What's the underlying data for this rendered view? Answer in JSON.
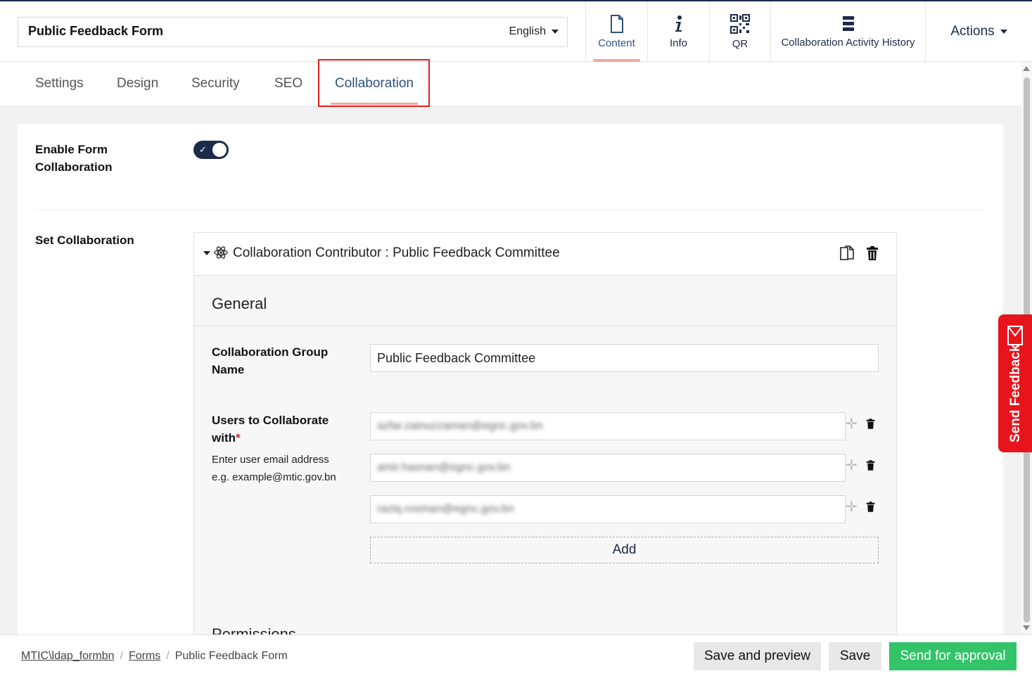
{
  "header": {
    "form_title": "Public Feedback Form",
    "language": "English",
    "tools": [
      {
        "label": "Content",
        "icon": "document-icon"
      },
      {
        "label": "Info",
        "icon": "info-icon"
      },
      {
        "label": "QR",
        "icon": "qr-code-icon"
      },
      {
        "label": "Collaboration Activity History",
        "icon": "list-icon"
      }
    ],
    "actions_label": "Actions"
  },
  "tabs": [
    {
      "label": "Settings"
    },
    {
      "label": "Design"
    },
    {
      "label": "Security"
    },
    {
      "label": "SEO"
    },
    {
      "label": "Collaboration",
      "active": true
    }
  ],
  "collaboration": {
    "enable_label": "Enable Form Collaboration",
    "enabled": true,
    "set_label": "Set Collaboration",
    "card_title": "Collaboration Contributor : Public Feedback Committee",
    "general_heading": "General",
    "group_name_label": "Collaboration Group Name",
    "group_name_value": "Public Feedback Committee",
    "users_label": "Users to Collaborate with",
    "required_mark": "*",
    "help_line1": "Enter user email address",
    "help_line2": "e.g. example@mtic.gov.bn",
    "users": [
      "azfar.zainuzzaman@egnc.gov.bn",
      "amir.hasnan@egnc.gov.bn",
      "raziq.rosman@egnc.gov.bn"
    ],
    "add_label": "Add",
    "permissions_heading": "Permissions"
  },
  "feedback_tab": "Send Feedback",
  "footer": {
    "breadcrumbs": [
      "MTIC\\ldap_formbn",
      "Forms",
      "Public Feedback Form"
    ],
    "save_preview": "Save and preview",
    "save": "Save",
    "send_approval": "Send for approval"
  },
  "colors": {
    "navy": "#1c2b4a",
    "accent": "#2c5282",
    "green": "#33c46a",
    "red": "#e8141c"
  }
}
